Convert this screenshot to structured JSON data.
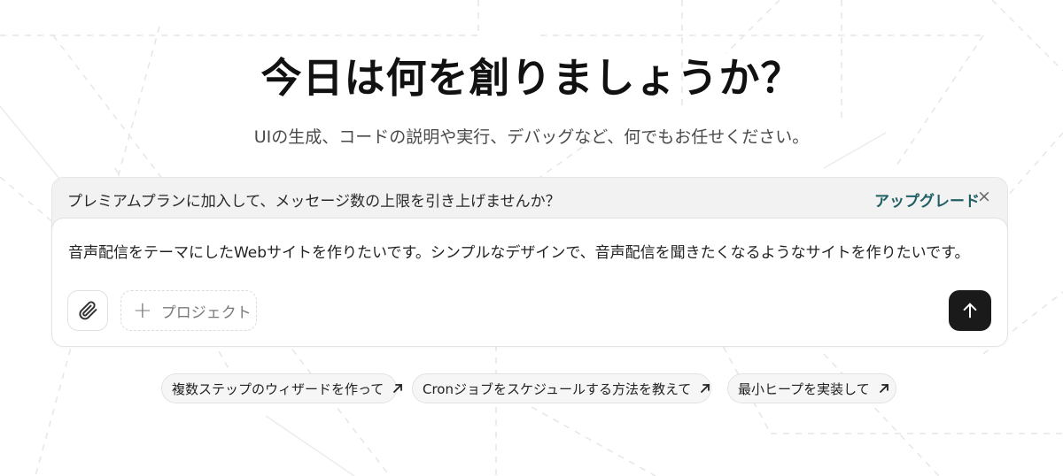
{
  "hero": {
    "title": "今日は何を創りましょうか？",
    "subtitle": "UIの生成、コードの説明や実行、デバッグなど、何でもお任せください。"
  },
  "upgrade_banner": {
    "text": "プレミアムプランに加入して、メッセージ数の上限を引き上げませんか？",
    "link_label": "アップグレード",
    "close_glyph": "×"
  },
  "composer": {
    "input_value": "音声配信をテーマにしたWebサイトを作りたいです。シンプルなデザインで、音声配信を聞きたくなるようなサイトを作りたいです。",
    "attach_icon": "paperclip-icon",
    "project_plus_glyph": "+",
    "project_label": "プロジェクト",
    "send_icon": "arrow-up-icon"
  },
  "suggestions": [
    {
      "label": "複数ステップのウィザードを作って"
    },
    {
      "label": "Cronジョブをスケジュールする方法を教えて"
    },
    {
      "label": "最小ヒープを実装して"
    }
  ],
  "colors": {
    "accent_link": "#1f5f63",
    "send_button": "#1a1a1a",
    "banner_bg": "#f2f2f3"
  }
}
